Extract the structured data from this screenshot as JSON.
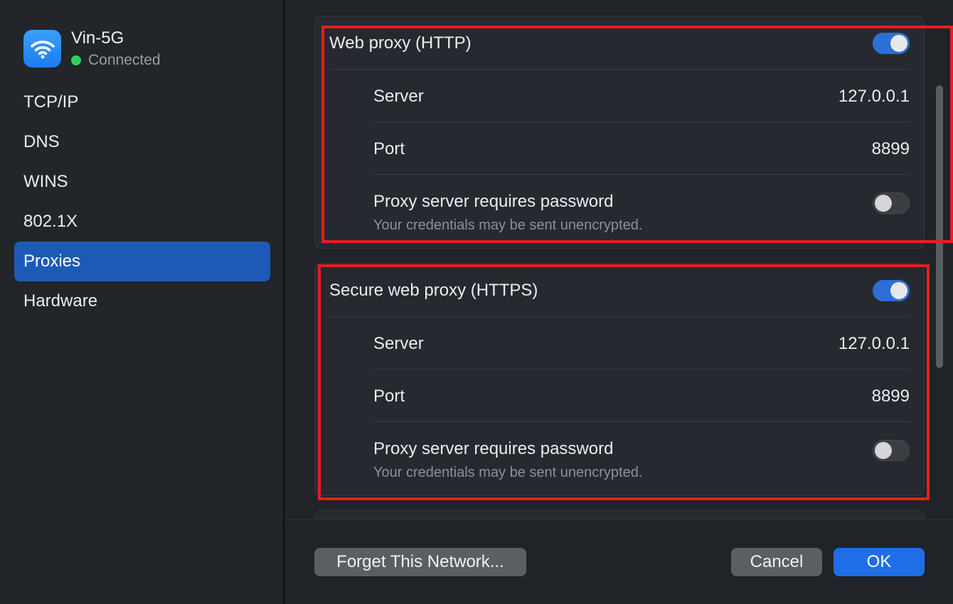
{
  "network": {
    "name": "Vin-5G",
    "status": "Connected",
    "icon": "wifi-icon",
    "status_color": "#30d158"
  },
  "sidebar": {
    "items": [
      {
        "label": "TCP/IP",
        "active": false
      },
      {
        "label": "DNS",
        "active": false
      },
      {
        "label": "WINS",
        "active": false
      },
      {
        "label": "802.1X",
        "active": false
      },
      {
        "label": "Proxies",
        "active": true
      },
      {
        "label": "Hardware",
        "active": false
      }
    ]
  },
  "http_proxy": {
    "title": "Web proxy (HTTP)",
    "enabled": true,
    "server_label": "Server",
    "server_value": "127.0.0.1",
    "port_label": "Port",
    "port_value": "8899",
    "password_label": "Proxy server requires password",
    "password_note": "Your credentials may be sent unencrypted.",
    "password_required": false
  },
  "https_proxy": {
    "title": "Secure web proxy (HTTPS)",
    "enabled": true,
    "server_label": "Server",
    "server_value": "127.0.0.1",
    "port_label": "Port",
    "port_value": "8899",
    "password_label": "Proxy server requires password",
    "password_note": "Your credentials may be sent unencrypted.",
    "password_required": false
  },
  "footer": {
    "forget_label": "Forget This Network...",
    "cancel_label": "Cancel",
    "ok_label": "OK"
  },
  "colors": {
    "accent": "#1f6ee8",
    "sidebar_active": "#1d5ab6",
    "highlight": "#ee1c1c"
  }
}
